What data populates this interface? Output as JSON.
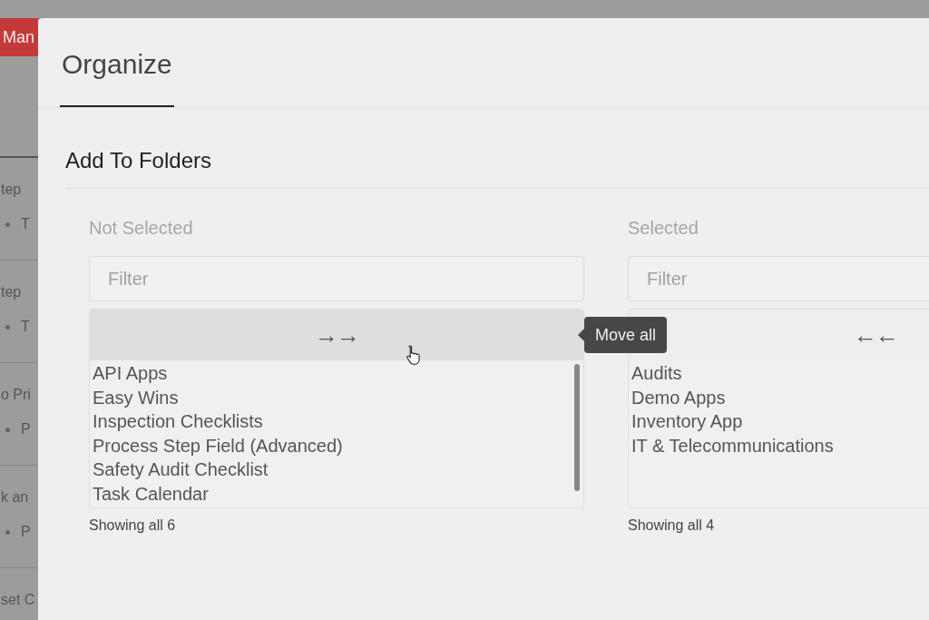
{
  "background_page": {
    "button": "Man",
    "rows": [
      {
        "title": "tep",
        "detail": "T"
      },
      {
        "title": "tep",
        "detail": "T"
      },
      {
        "title": "o Pri",
        "detail": "P"
      },
      {
        "title": "k an",
        "detail": "P"
      },
      {
        "title": "set C"
      }
    ]
  },
  "dialog": {
    "title": "Organize",
    "section_title": "Add To Folders",
    "lists": [
      {
        "label": "Not Selected",
        "filter_placeholder": "Filter",
        "move_all": "→→",
        "hovered": true,
        "items": [
          "API Apps",
          "Easy Wins",
          "Inspection Checklists",
          "Process Step Field (Advanced)",
          "Safety Audit Checklist",
          "Task Calendar"
        ],
        "footer": "Showing all 6"
      },
      {
        "label": "Selected",
        "filter_placeholder": "Filter",
        "move_all": "←←",
        "hovered": false,
        "items": [
          "Audits",
          "Demo Apps",
          "Inventory App",
          "IT & Telecommunications"
        ],
        "footer": "Showing all 4"
      }
    ],
    "tooltip": "Move all"
  }
}
